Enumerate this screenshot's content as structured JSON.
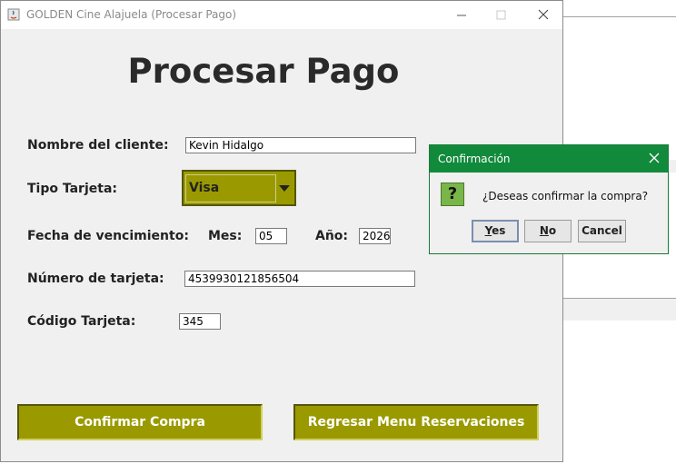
{
  "window": {
    "title": "GOLDEN Cine Alajuela (Procesar Pago)"
  },
  "page": {
    "heading": "Procesar Pago"
  },
  "form": {
    "cliente_label": "Nombre del cliente:",
    "cliente_value": "Kevin Hidalgo",
    "tipo_label": "Tipo Tarjeta:",
    "tipo_value": "Visa",
    "venc_label": "Fecha de vencimiento:",
    "mes_label": "Mes:",
    "mes_value": "05",
    "anio_label": "Año:",
    "anio_value": "2026",
    "numero_label": "Número de tarjeta:",
    "numero_value": "4539930121856504",
    "codigo_label": "Código Tarjeta:",
    "codigo_value": "345"
  },
  "buttons": {
    "confirmar": "Confirmar Compra",
    "regresar": "Regresar Menu Reservaciones"
  },
  "dialog": {
    "title": "Confirmación",
    "message": "¿Deseas confirmar la compra?",
    "yes_first": "Y",
    "yes_rest": "es",
    "no_first": "N",
    "no_rest": "o",
    "cancel": "Cancel"
  },
  "colors": {
    "accent": "#9a9a00",
    "dialog_title": "#118a3c"
  }
}
